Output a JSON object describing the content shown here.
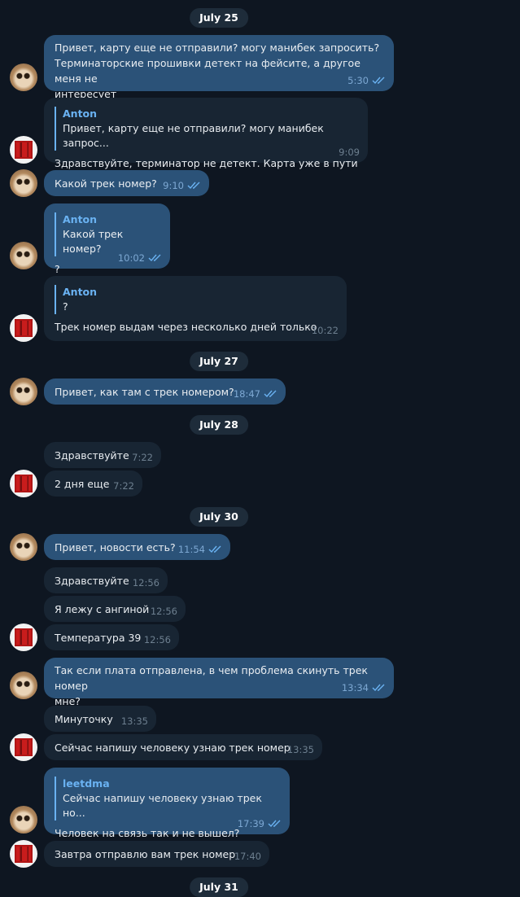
{
  "dates": [
    "July 25",
    "July 27",
    "July 28",
    "July 30",
    "July 31"
  ],
  "messages": [
    {
      "text": "Привет, карту еще не отправили? могу манибек запросить?\nТерминаторские прошивки детект на фейсите, а другое меня не\nинтересует",
      "time": "5:30"
    },
    {
      "quote_name": "Anton",
      "quote_text": "Привет, карту еще не отправили? могу манибек запрос...",
      "text": "Здравствуйте, терминатор не детект. Карта уже в пути",
      "time": "9:09"
    },
    {
      "text": "Какой трек номер?",
      "time": "9:10"
    },
    {
      "quote_name": "Anton",
      "quote_text": "Какой трек номер?",
      "text": "?",
      "time": "10:02"
    },
    {
      "quote_name": "Anton",
      "quote_text": "?",
      "text": "Трек номер выдам через несколько дней только",
      "time": "10:22"
    },
    {
      "text": "Привет, как там с трек номером?",
      "time": "18:47"
    },
    {
      "text": "Здравствуйте",
      "time": "7:22"
    },
    {
      "text": "2 дня еще",
      "time": "7:22"
    },
    {
      "text": "Привет, новости есть?",
      "time": "11:54"
    },
    {
      "text": "Здравствуйте",
      "time": "12:56"
    },
    {
      "text": "Я лежу с ангиной",
      "time": "12:56"
    },
    {
      "text": "Температура 39",
      "time": "12:56"
    },
    {
      "text": "Так если плата отправлена, в чем проблема скинуть трек номер\nмне?",
      "time": "13:34"
    },
    {
      "text": "Минуточку",
      "time": "13:35"
    },
    {
      "text": "Сейчас напишу человеку узнаю трек номер",
      "time": "13:35"
    },
    {
      "quote_name": "leetdma",
      "quote_text": "Сейчас напишу человеку узнаю трек но...",
      "text": "Человек на связь так и не вышел?",
      "time": "17:39"
    },
    {
      "text": "Завтра отправлю вам трек номер",
      "time": "17:40"
    }
  ],
  "colors": {
    "background": "#0e1621",
    "outgoing": "#2b5278",
    "incoming": "#182533",
    "accent": "#6ab2f2"
  },
  "icons": {
    "read_receipt": "double-check-icon",
    "user_avatar": "cat-avatar",
    "seller_avatar": "board-avatar"
  }
}
